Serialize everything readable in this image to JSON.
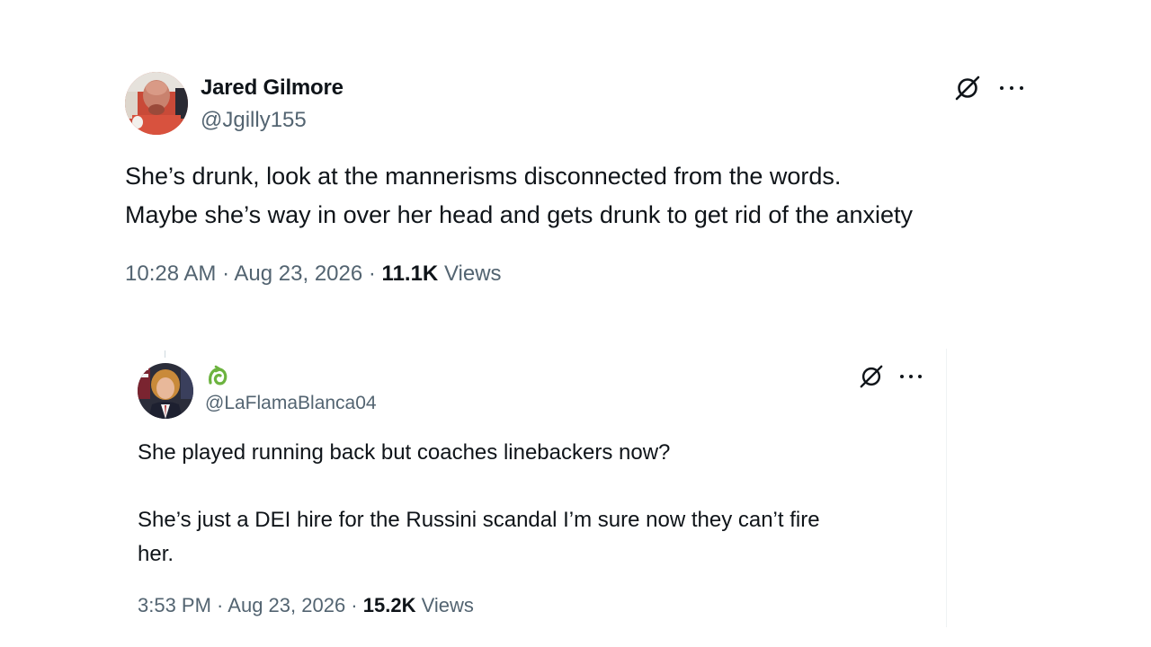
{
  "tweets": [
    {
      "name": "Jared Gilmore",
      "handle": "@Jgilly155",
      "lines": [
        "She’s drunk, look at the mannerisms disconnected from the words.",
        "Maybe she’s way in over her head and gets drunk to get rid of the anxiety"
      ],
      "time": "10:28 AM",
      "date": "Aug 23, 2026",
      "views_count": "11.1K",
      "views_label": "Views"
    },
    {
      "handle": "@LaFlamaBlanca04",
      "lines": [
        "She played running back but coaches linebackers now?",
        "She’s just a DEI hire for the Russini scandal I’m sure now they can’t fire",
        "her."
      ],
      "time": "3:53 PM",
      "date": "Aug 23, 2026",
      "views_count": "15.2K",
      "views_label": "Views"
    }
  ],
  "separator": " · ",
  "icons": {
    "grok": "grok-icon",
    "more": "more-options-icon",
    "badge": "green-badge-icon"
  },
  "colors": {
    "text_primary": "#0f1419",
    "text_secondary": "#536471",
    "badge_green": "#6cb33f"
  }
}
